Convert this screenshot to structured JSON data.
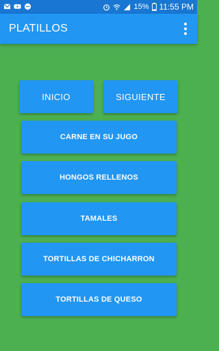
{
  "statusbar": {
    "battery": "15%",
    "time": "11:55 PM",
    "icons": [
      "notification-icon",
      "youtube-icon",
      "chat-icon",
      "alarm-icon",
      "wifi-icon",
      "signal-icon",
      "battery-icon"
    ]
  },
  "appbar": {
    "title": "PLATILLOS",
    "menu_icon": "overflow-menu-icon"
  },
  "nav": {
    "inicio": "INICIO",
    "siguiente": "SIGUIENTE"
  },
  "items": [
    "CARNE EN SU JUGO",
    "HONGOS RELLENOS",
    "TAMALES",
    "TORTILLAS DE CHICHARRON",
    "TORTILLAS DE QUESO"
  ],
  "colors": {
    "background": "#4CAF50",
    "primary": "#2196F3",
    "status_bar": "#1976D2"
  }
}
